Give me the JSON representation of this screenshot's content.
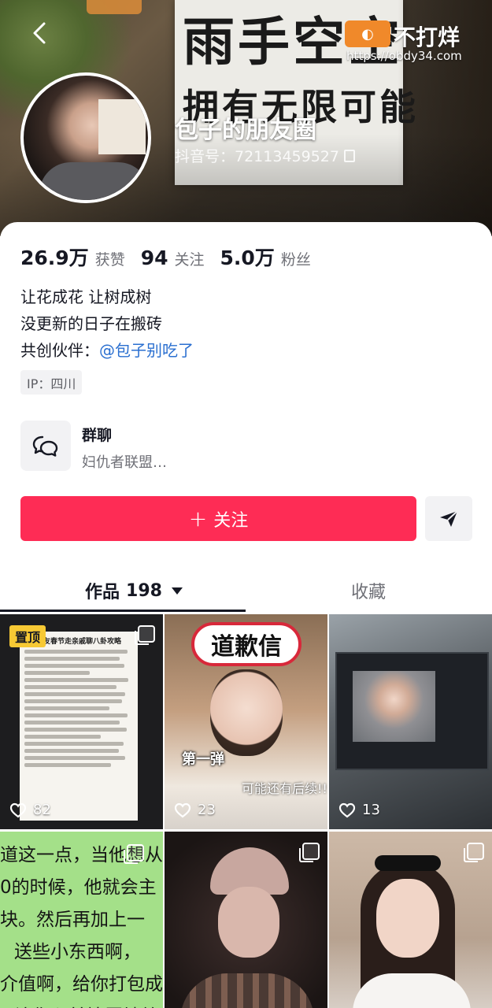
{
  "header": {
    "nickname": "包子的朋友圈",
    "douyin_id": "抖音号：72113459527",
    "watermark_title": "不打烊",
    "watermark_url": "https://obdy34.com",
    "poster_line1": "雨手空空",
    "poster_line2": "拥有无限可能"
  },
  "stats": {
    "likes_value": "26.9万",
    "likes_label": "获赞",
    "following_value": "94",
    "following_label": "关注",
    "followers_value": "5.0万",
    "followers_label": "粉丝"
  },
  "bio": {
    "line1": "让花成花 让树成树",
    "line2": "没更新的日子在搬砖",
    "partner_prefix": "共创伙伴：",
    "partner_mention": "@包子别吃了"
  },
  "ip": "IP：四川",
  "group_chat": {
    "title": "群聊",
    "subtitle": "妇仇者联盟…"
  },
  "actions": {
    "follow_plus": "+",
    "follow_label": "关注"
  },
  "tabs": {
    "works_label": "作品",
    "works_count": "198",
    "favorites_label": "收藏"
  },
  "videos": [
    {
      "pinned_label": "置顶",
      "likes": "82",
      "doc_title": "大友春节走亲戚聊八卦攻略"
    },
    {
      "likes": "23",
      "sign": "道歉信",
      "overlay1": "第一弹",
      "overlay2": "可能还有后续!!"
    },
    {
      "likes": "13"
    },
    {
      "text_lines": [
        "道这一点，当他想从",
        "0的时候，他就会主",
        "块。然后再加上一",
        "送些小东西啊，",
        "介值啊，给你打包成",
        "让你心甘情愿地给"
      ]
    },
    {},
    {}
  ],
  "colors": {
    "primary": "#fe2c55",
    "mention": "#2a6fd0",
    "pin": "#f7c934"
  }
}
